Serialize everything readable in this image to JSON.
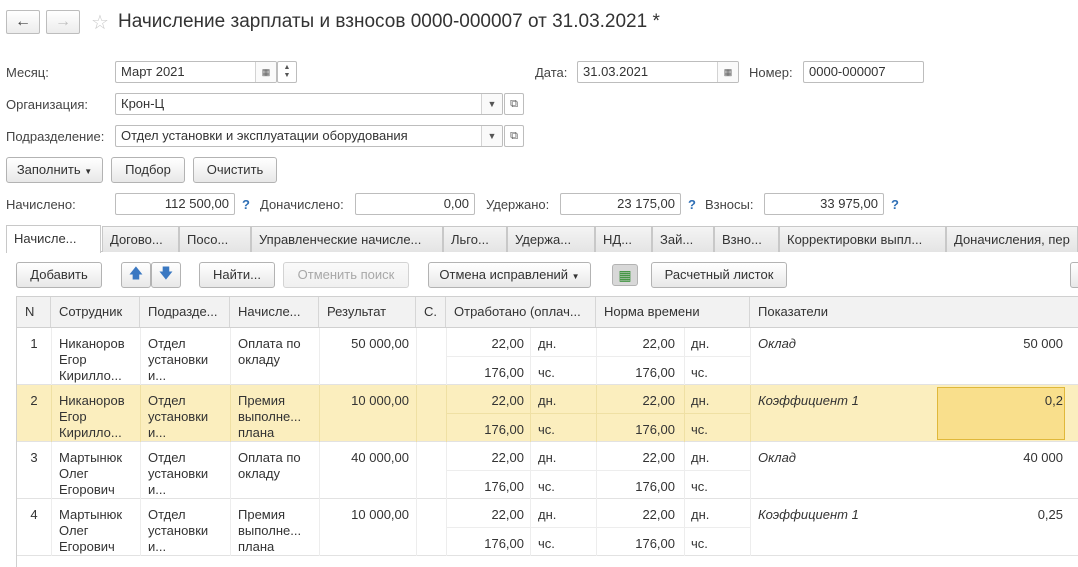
{
  "window": {
    "title": "Начисление зарплаты и взносов 0000-000007 от 31.03.2021 *",
    "back_icon": "arrow-left-icon",
    "forward_icon": "arrow-right-icon",
    "favorite_icon": "star-icon"
  },
  "form": {
    "month_label": "Месяц:",
    "month_value": "Март 2021",
    "date_label": "Дата:",
    "date_value": "31.03.2021",
    "number_label": "Номер:",
    "number_value": "0000-000007",
    "org_label": "Организация:",
    "org_value": "Крон-Ц",
    "dept_label": "Подразделение:",
    "dept_value": "Отдел установки и эксплуатации оборудования"
  },
  "actions": {
    "fill": "Заполнить",
    "select": "Подбор",
    "clear": "Очистить"
  },
  "totals": {
    "accrued_label": "Начислено:",
    "accrued_value": "112 500,00",
    "extra_label": "Доначислено:",
    "extra_value": "0,00",
    "withheld_label": "Удержано:",
    "withheld_value": "23 175,00",
    "contrib_label": "Взносы:",
    "contrib_value": "33 975,00",
    "help": "?"
  },
  "tabs": [
    {
      "label": "Начисле..."
    },
    {
      "label": "Догово..."
    },
    {
      "label": "Посо..."
    },
    {
      "label": "Управленческие начисле..."
    },
    {
      "label": "Льго..."
    },
    {
      "label": "Удержа..."
    },
    {
      "label": "НД..."
    },
    {
      "label": "Зай..."
    },
    {
      "label": "Взно..."
    },
    {
      "label": "Корректировки выпл..."
    },
    {
      "label": "Доначисления, пер"
    }
  ],
  "toolbar": {
    "add": "Добавить",
    "find": "Найти...",
    "cancel_search": "Отменить поиск",
    "cancel_corrections": "Отмена исправлений",
    "payslip": "Расчетный листок"
  },
  "table": {
    "headers": [
      "N",
      "Сотрудник",
      "Подразде...",
      "Начисле...",
      "Результат",
      "С.",
      "Отработано (оплач...",
      "Норма времени",
      "Показатели"
    ],
    "rows": [
      {
        "n": "1",
        "emp": [
          "Никаноров",
          "Егор",
          "Кирилло..."
        ],
        "dept": [
          "Отдел",
          "установки",
          "и..."
        ],
        "accr": [
          "Оплата по",
          "окладу"
        ],
        "result": "50 000,00",
        "worked1": "22,00",
        "unit1": "дн.",
        "worked2": "176,00",
        "unit2": "чс.",
        "norm1": "22,00",
        "nunit1": "дн.",
        "norm2": "176,00",
        "nunit2": "чс.",
        "ind_name": "Оклад",
        "ind_value": "50 000",
        "selected": false
      },
      {
        "n": "2",
        "emp": [
          "Никаноров",
          "Егор",
          "Кирилло..."
        ],
        "dept": [
          "Отдел",
          "установки",
          "и..."
        ],
        "accr": [
          "Премия",
          "выполне...",
          "плана"
        ],
        "result": "10 000,00",
        "worked1": "22,00",
        "unit1": "дн.",
        "worked2": "176,00",
        "unit2": "чс.",
        "norm1": "22,00",
        "nunit1": "дн.",
        "norm2": "176,00",
        "nunit2": "чс.",
        "ind_name": "Коэффициент 1",
        "ind_value": "0,2",
        "selected": true
      },
      {
        "n": "3",
        "emp": [
          "Мартынюк",
          "Олег",
          "Егорович"
        ],
        "dept": [
          "Отдел",
          "установки",
          "и..."
        ],
        "accr": [
          "Оплата по",
          "окладу"
        ],
        "result": "40 000,00",
        "worked1": "22,00",
        "unit1": "дн.",
        "worked2": "176,00",
        "unit2": "чс.",
        "norm1": "22,00",
        "nunit1": "дн.",
        "norm2": "176,00",
        "nunit2": "чс.",
        "ind_name": "Оклад",
        "ind_value": "40 000",
        "selected": false
      },
      {
        "n": "4",
        "emp": [
          "Мартынюк",
          "Олег",
          "Егорович"
        ],
        "dept": [
          "Отдел",
          "установки",
          "и..."
        ],
        "accr": [
          "Премия",
          "выполне...",
          "плана"
        ],
        "result": "10 000,00",
        "worked1": "22,00",
        "unit1": "дн.",
        "worked2": "176,00",
        "unit2": "чс.",
        "norm1": "22,00",
        "nunit1": "дн.",
        "norm2": "176,00",
        "nunit2": "чс.",
        "ind_name": "Коэффициент 1",
        "ind_value": "0,25",
        "selected": false
      }
    ]
  }
}
